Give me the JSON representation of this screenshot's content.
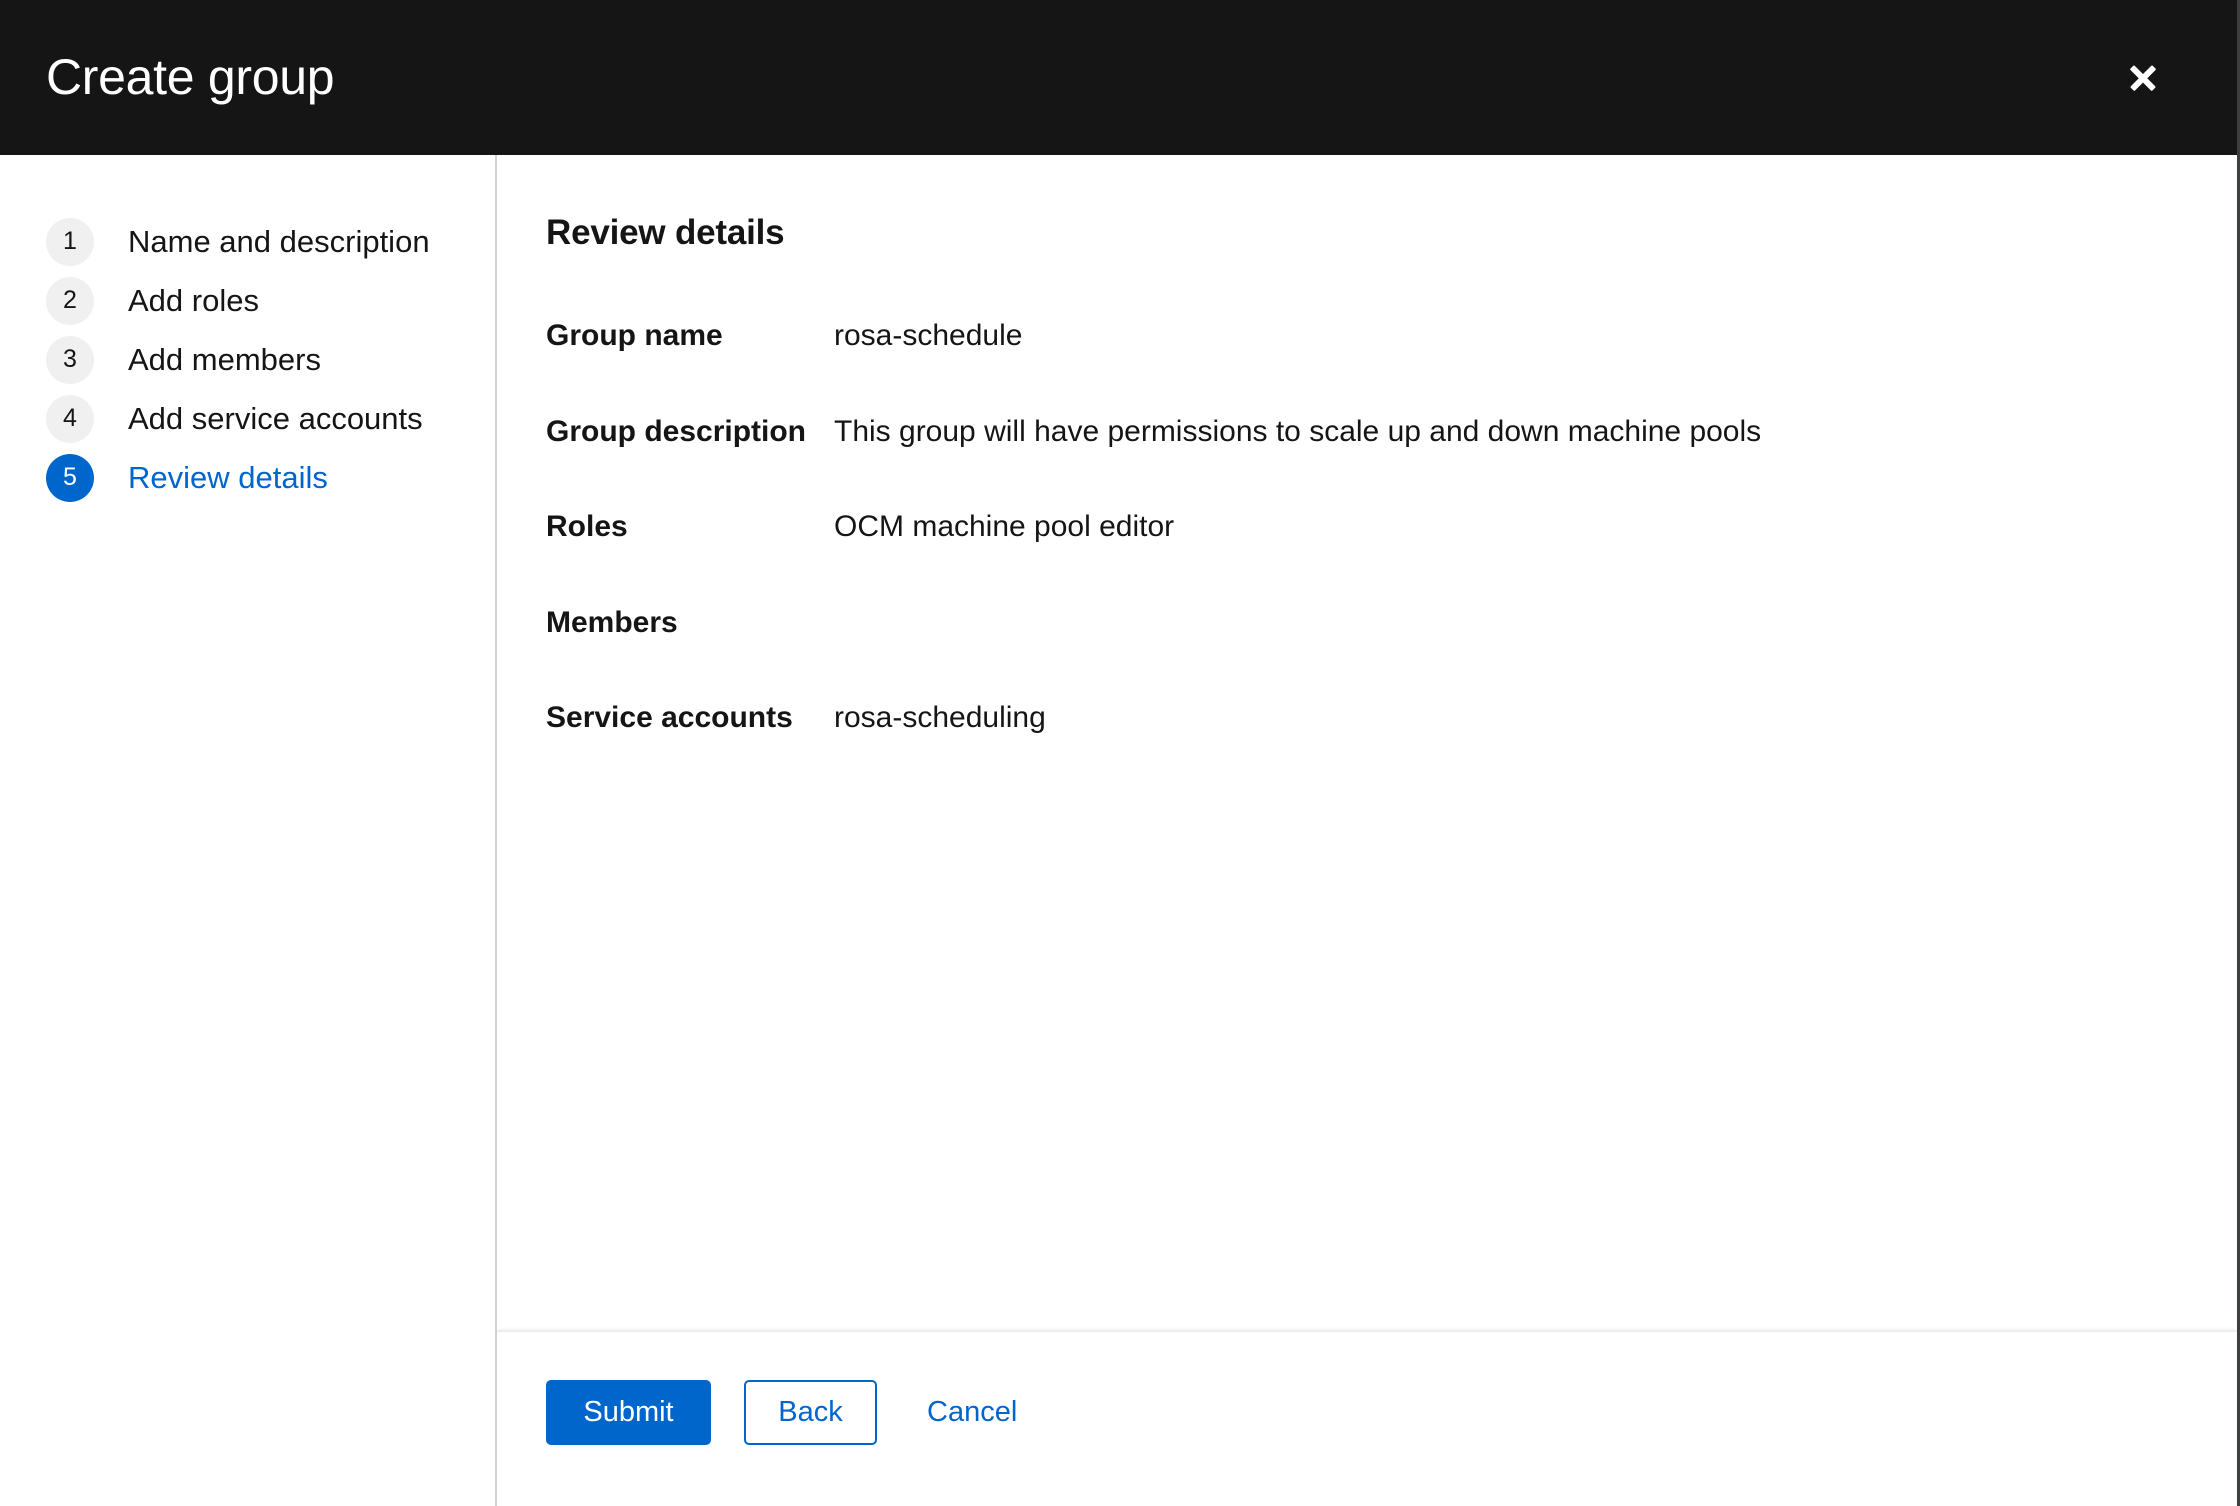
{
  "header": {
    "title": "Create group",
    "close_icon": "close-icon"
  },
  "wizard": {
    "steps": [
      {
        "number": "1",
        "label": "Name and description",
        "current": false
      },
      {
        "number": "2",
        "label": "Add roles",
        "current": false
      },
      {
        "number": "3",
        "label": "Add members",
        "current": false
      },
      {
        "number": "4",
        "label": "Add service accounts",
        "current": false
      },
      {
        "number": "5",
        "label": "Review details",
        "current": true
      }
    ]
  },
  "content": {
    "title": "Review details",
    "details": [
      {
        "term": "Group name",
        "value": "rosa-schedule"
      },
      {
        "term": "Group description",
        "value": "This group will have permissions to scale up and down machine pools"
      },
      {
        "term": "Roles",
        "value": "OCM machine pool editor"
      },
      {
        "term": "Members",
        "value": ""
      },
      {
        "term": "Service accounts",
        "value": "rosa-scheduling"
      }
    ]
  },
  "footer": {
    "submit_label": "Submit",
    "back_label": "Back",
    "cancel_label": "Cancel"
  },
  "colors": {
    "header_background": "#151515",
    "accent_blue": "#0066cc",
    "step_circle_default": "#f0f0f0",
    "divider": "#d2d2d2",
    "text": "#151515"
  }
}
